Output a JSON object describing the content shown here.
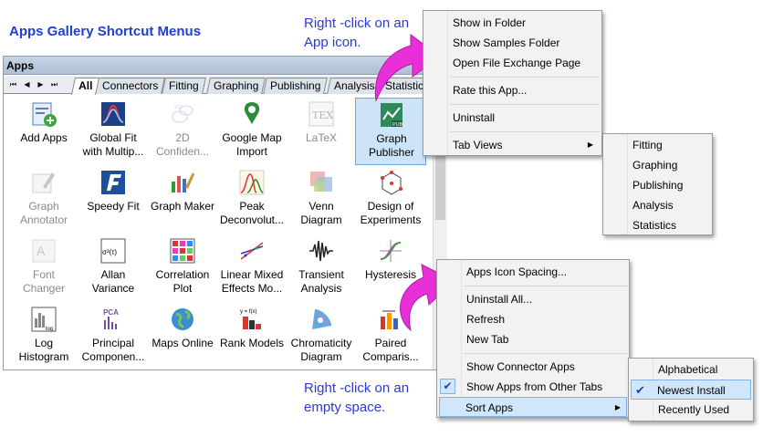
{
  "title": "Apps Gallery Shortcut Menus",
  "callout_top": [
    "Right -click on an",
    "App icon."
  ],
  "callout_bottom": [
    "Right -click on an",
    "empty space."
  ],
  "panel": {
    "title": "Apps",
    "pin": "✕",
    "nav": [
      "⏮",
      "◀",
      "▶",
      "⏭"
    ],
    "tabs": [
      "All",
      "Connectors",
      "Fitting",
      "Graphing",
      "Publishing",
      "Analysis",
      "Statistics"
    ]
  },
  "apps": [
    {
      "label1": "Add Apps",
      "label2": "",
      "icon": "add-apps-icon",
      "dim": false
    },
    {
      "label1": "Global Fit",
      "label2": "with Multip...",
      "icon": "global-fit-icon",
      "dim": false
    },
    {
      "label1": "2D",
      "label2": "Confiden...",
      "icon": "2d-confidence-icon",
      "dim": true
    },
    {
      "label1": "Google Map",
      "label2": "Import",
      "icon": "google-map-icon",
      "dim": false
    },
    {
      "label1": "LaTeX",
      "label2": "",
      "icon": "latex-icon",
      "dim": true
    },
    {
      "label1": "Graph",
      "label2": "Publisher",
      "icon": "graph-publisher-icon",
      "dim": false,
      "selected": true
    },
    {
      "label1": "Graph",
      "label2": "Annotator",
      "icon": "graph-annotator-icon",
      "dim": true
    },
    {
      "label1": "Speedy Fit",
      "label2": "",
      "icon": "speedy-fit-icon",
      "dim": false
    },
    {
      "label1": "Graph Maker",
      "label2": "",
      "icon": "graph-maker-icon",
      "dim": false
    },
    {
      "label1": "Peak",
      "label2": "Deconvolut...",
      "icon": "peak-deconvolution-icon",
      "dim": false
    },
    {
      "label1": "Venn",
      "label2": "Diagram",
      "icon": "venn-diagram-icon",
      "dim": false
    },
    {
      "label1": "Design of",
      "label2": "Experiments",
      "icon": "design-of-experiments-icon",
      "dim": false
    },
    {
      "label1": "Font",
      "label2": "Changer",
      "icon": "font-changer-icon",
      "dim": true
    },
    {
      "label1": "Allan",
      "label2": "Variance",
      "icon": "allan-variance-icon",
      "dim": false
    },
    {
      "label1": "Correlation",
      "label2": "Plot",
      "icon": "correlation-plot-icon",
      "dim": false
    },
    {
      "label1": "Linear Mixed",
      "label2": "Effects Mo...",
      "icon": "linear-mixed-icon",
      "dim": false
    },
    {
      "label1": "Transient",
      "label2": "Analysis",
      "icon": "transient-analysis-icon",
      "dim": false
    },
    {
      "label1": "Hysteresis",
      "label2": "",
      "icon": "hysteresis-icon",
      "dim": false
    },
    {
      "label1": "Log",
      "label2": "Histogram",
      "icon": "log-histogram-icon",
      "dim": false
    },
    {
      "label1": "Principal",
      "label2": "Componen...",
      "icon": "pca-icon",
      "dim": false
    },
    {
      "label1": "Maps Online",
      "label2": "",
      "icon": "maps-online-icon",
      "dim": false
    },
    {
      "label1": "Rank Models",
      "label2": "",
      "icon": "rank-models-icon",
      "dim": false
    },
    {
      "label1": "Chromaticity",
      "label2": "Diagram",
      "icon": "chromaticity-icon",
      "dim": false
    },
    {
      "label1": "Paired",
      "label2": "Comparis...",
      "icon": "paired-comparison-icon",
      "dim": false
    }
  ],
  "icon_text": {
    "latex": "TEX",
    "pca": "PCA",
    "allan": "σ²(τ)",
    "rank": "y = f(x)",
    "log": "log",
    "pub": "PUB"
  },
  "app_menu": {
    "items": [
      "Show in Folder",
      "Show Samples Folder",
      "Open File Exchange Page",
      "Rate this App...",
      "Uninstall",
      "Tab Views"
    ],
    "submenu": [
      "Fitting",
      "Graphing",
      "Publishing",
      "Analysis",
      "Statistics"
    ]
  },
  "space_menu": {
    "items": [
      "Apps Icon Spacing...",
      "Uninstall All...",
      "Refresh",
      "New Tab",
      "Show Connector Apps",
      "Show Apps from Other Tabs",
      "Sort Apps"
    ],
    "submenu": [
      "Alphabetical",
      "Newest Install",
      "Recently Used"
    ]
  },
  "colors": {
    "accent": "#2b39d6",
    "arrow": "#e82fd8",
    "highlight": "#cfe6fb"
  }
}
